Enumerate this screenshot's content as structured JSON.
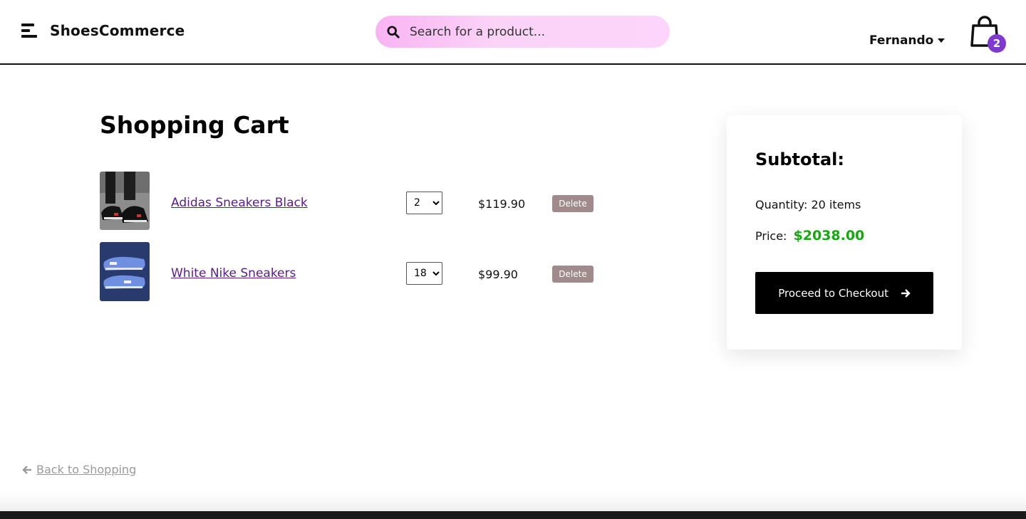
{
  "header": {
    "brand": "ShoesCommerce",
    "search_placeholder": "Search for a product...",
    "user_name": "Fernando",
    "cart_count": "2"
  },
  "cart": {
    "title": "Shopping Cart",
    "items": [
      {
        "name": "Adidas Sneakers Black",
        "quantity": "2",
        "price": "$119.90",
        "delete_label": "Delete"
      },
      {
        "name": "White Nike Sneakers",
        "quantity": "18",
        "price": "$99.90",
        "delete_label": "Delete"
      }
    ]
  },
  "summary": {
    "title": "Subtotal:",
    "quantity_text": "Quantity: 20 items",
    "price_label": "Price:",
    "price_value": "$2038.00",
    "checkout_label": "Proceed to Checkout"
  },
  "back_link": "Back to Shopping",
  "colors": {
    "accent_purple": "#7e3ad0",
    "price_green": "#15a80f",
    "link_purple": "#5a1a8c",
    "delete_gray": "#a08a8c"
  }
}
